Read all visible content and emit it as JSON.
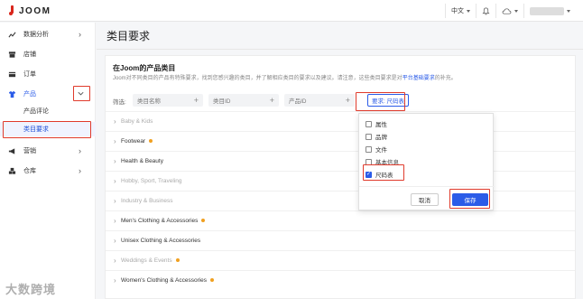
{
  "header": {
    "logo_text": "JOOM",
    "language": "中文",
    "user_name_hidden": ""
  },
  "sidebar": {
    "items": [
      {
        "label": "数据分析",
        "icon": "trend-icon"
      },
      {
        "label": "店铺",
        "icon": "store-icon"
      },
      {
        "label": "订单",
        "icon": "order-icon"
      },
      {
        "label": "产品",
        "icon": "product-icon"
      },
      {
        "label": "产品评论"
      },
      {
        "label": "类目要求"
      },
      {
        "label": "营销",
        "icon": "megaphone-icon"
      },
      {
        "label": "仓库",
        "icon": "warehouse-icon"
      }
    ]
  },
  "main": {
    "title": "类目要求",
    "card_title": "在Joom的产品类目",
    "card_desc_prefix": "Joom对不同类目的产品有特殊要求，找到您感兴趣的类目，并了解相应类目的要求以及建议。请注意，这些类目要求是对",
    "card_desc_link": "平台基础要求",
    "card_desc_suffix": "的补充。",
    "filter_label": "筛选:",
    "filters": [
      {
        "placeholder": "类目名称"
      },
      {
        "placeholder": "类目ID"
      },
      {
        "placeholder": "产品ID"
      }
    ],
    "requirement_select": "要求: 尺码表",
    "categories": [
      {
        "name": "Baby & Kids",
        "dim": true,
        "dot": false
      },
      {
        "name": "Footwear",
        "dim": false,
        "dot": true
      },
      {
        "name": "Health & Beauty",
        "dim": false,
        "dot": false
      },
      {
        "name": "Hobby, Sport, Traveling",
        "dim": true,
        "dot": false
      },
      {
        "name": "Industry & Business",
        "dim": true,
        "dot": false
      },
      {
        "name": "Men's Clothing & Accessories",
        "dim": false,
        "dot": true
      },
      {
        "name": "Unisex Clothing & Accessories",
        "dim": false,
        "dot": false
      },
      {
        "name": "Weddings & Events",
        "dim": true,
        "dot": true
      },
      {
        "name": "Women's Clothing & Accessories",
        "dim": false,
        "dot": true
      }
    ]
  },
  "dropdown": {
    "options": [
      {
        "label": "属性",
        "checked": false
      },
      {
        "label": "品牌",
        "checked": false
      },
      {
        "label": "文件",
        "checked": false
      },
      {
        "label": "基本信息",
        "checked": false
      },
      {
        "label": "尺码表",
        "checked": true
      }
    ],
    "cancel_label": "取消",
    "save_label": "保存"
  },
  "watermark": "大数跨境",
  "colors": {
    "accent": "#2b5ce8",
    "highlight": "#e03b2c",
    "dot": "#f0a020"
  }
}
